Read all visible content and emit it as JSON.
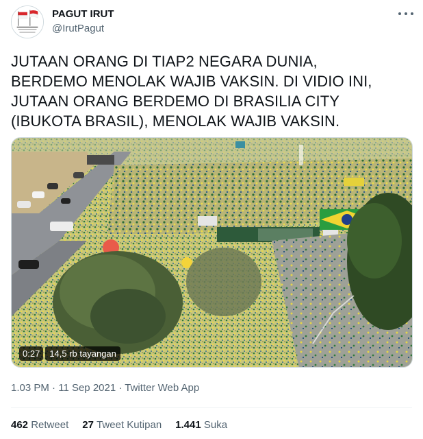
{
  "author": {
    "name": "PAGUT IRUT",
    "handle": "@IrutPagut"
  },
  "tweet": {
    "text": "JUTAAN ORANG DI TIAP2 NEGARA DUNIA,\nBERDEMO MENOLAK WAJIB VAKSIN. DI VIDIO INI,\nJUTAAN ORANG BERDEMO DI BRASILIA CITY\n(IBUKOTA BRASIL), MENOLAK WAJIB VAKSIN."
  },
  "video": {
    "duration": "0:27",
    "views": "14,5 rb tayangan"
  },
  "meta": {
    "time": "1.03 PM",
    "date": "11 Sep 2021",
    "source": "Twitter Web App",
    "separator": "·"
  },
  "stats": {
    "retweets_count": "462",
    "retweets_label": "Retweet",
    "quotes_count": "27",
    "quotes_label": "Tweet Kutipan",
    "likes_count": "1.441",
    "likes_label": "Suka"
  },
  "icons": {
    "more": "more-horizontal-icon"
  }
}
